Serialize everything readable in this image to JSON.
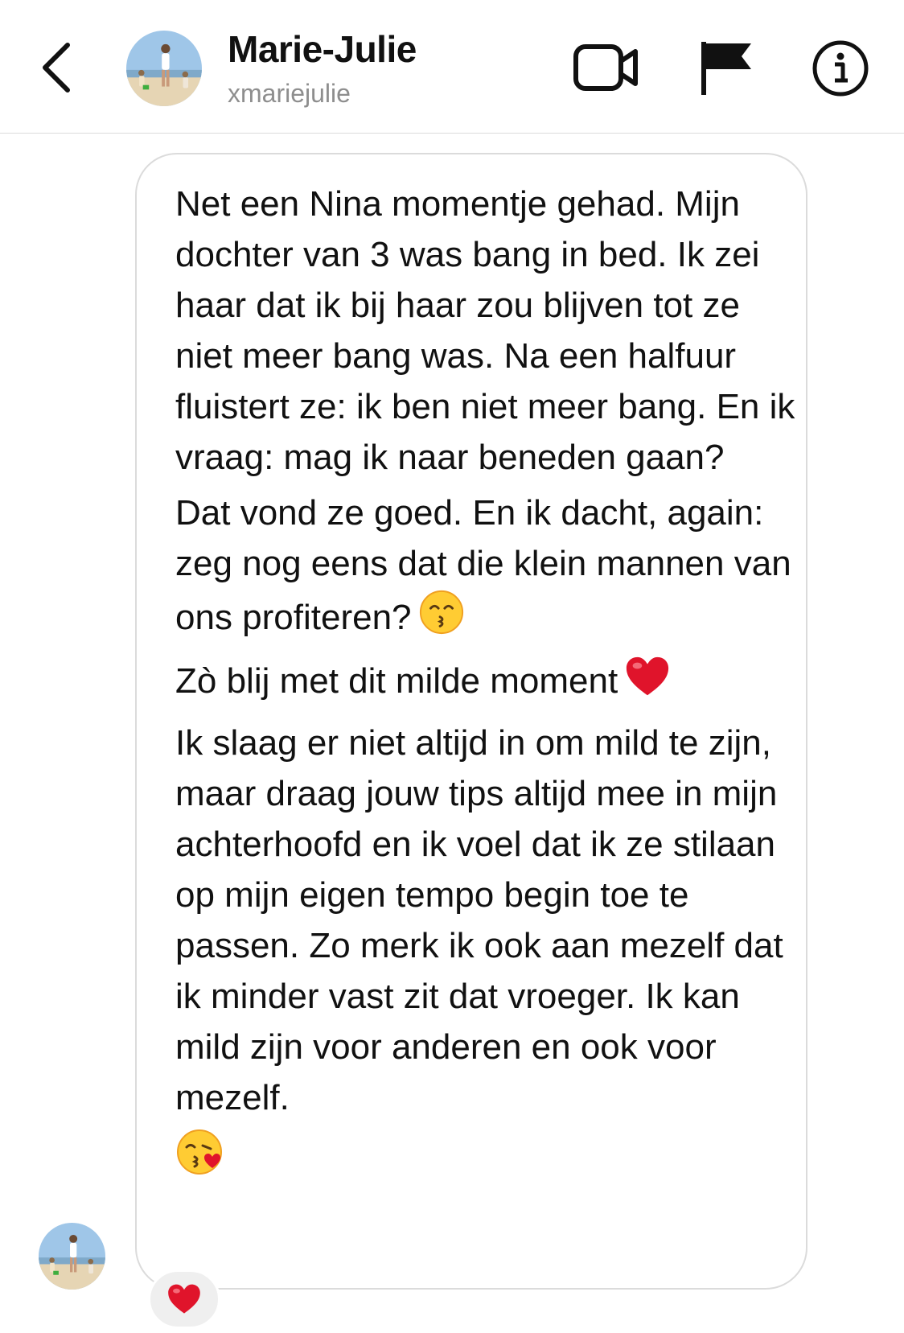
{
  "header": {
    "name": "Marie-Julie",
    "username": "xmariejulie",
    "icons": [
      "chevron-left-icon",
      "video-camera-icon",
      "flag-icon",
      "info-icon"
    ]
  },
  "message": {
    "paragraphs": [
      "Net een Nina momentje gehad. Mijn dochter van 3 was bang in bed. Ik zei haar dat ik bij haar zou blijven tot ze niet meer bang was. Na een halfuur fluistert ze: ik ben niet meer bang. En ik vraag: mag ik naar beneden gaan?",
      "Dat vond ze goed. En ik dacht, again: zeg nog eens dat die klein mannen van ons profiteren?",
      "Zò blij met dit milde moment",
      "Ik slaag er niet altijd in om mild te zijn, maar draag jouw tips altijd mee in mijn achterhoofd en ik voel dat ik ze stilaan op mijn eigen tempo begin toe te passen. Zo merk ik ook aan mezelf dat ik minder vast zit dat vroeger. Ik kan mild zijn voor anderen en ook voor mezelf."
    ],
    "emojis": [
      "kissing-smiling-eyes-emoji",
      "red-heart-emoji",
      "face-blowing-kiss-emoji"
    ]
  },
  "reaction": {
    "icon": "red-heart-emoji"
  },
  "colors": {
    "bubble_border": "#dbdbdb",
    "username_gray": "#8e8e8e",
    "heart_red": "#e0142b",
    "reaction_bg": "#efefef"
  }
}
